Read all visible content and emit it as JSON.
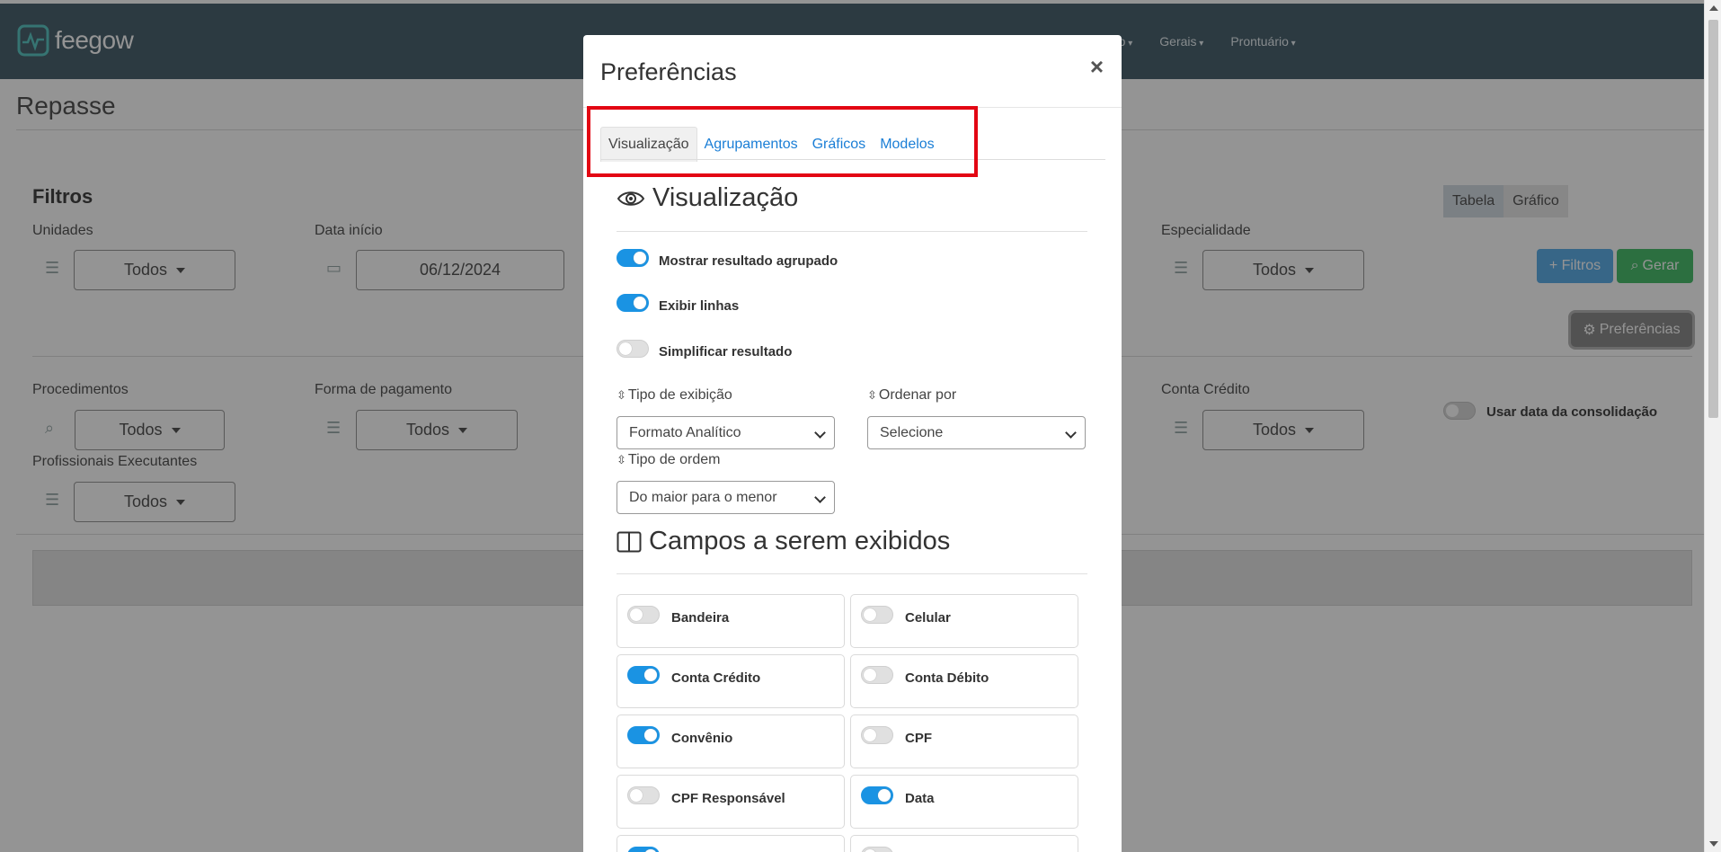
{
  "app": {
    "logo_text": "feegow"
  },
  "nav": {
    "items": [
      "ro",
      "Gerais",
      "Prontuário"
    ]
  },
  "page": {
    "title": "Repasse"
  },
  "filters": {
    "title": "Filtros",
    "unidades": {
      "label": "Unidades",
      "value": "Todos"
    },
    "data_inicio": {
      "label": "Data início",
      "value": "06/12/2024"
    },
    "especialidade": {
      "label": "Especialidade",
      "value": "Todos"
    },
    "procedimentos": {
      "label": "Procedimentos",
      "value": "Todos"
    },
    "forma_pagamento": {
      "label": "Forma de pagamento",
      "value": "Todos"
    },
    "conta_credito": {
      "label": "Conta Crédito",
      "value": "Todos"
    },
    "profissionais": {
      "label": "Profissionais Executantes",
      "value": "Todos"
    },
    "usar_data": {
      "label": "Usar data da consolidação",
      "on": false
    }
  },
  "view_switch": {
    "tabela": "Tabela",
    "grafico": "Gráfico",
    "active": "Tabela"
  },
  "actions": {
    "filtros": "+ Filtros",
    "gerar": "Gerar",
    "preferencias": "Preferências"
  },
  "modal": {
    "title": "Preferências",
    "close": "×",
    "tabs": [
      {
        "label": "Visualização",
        "active": true
      },
      {
        "label": "Agrupamentos",
        "active": false
      },
      {
        "label": "Gráficos",
        "active": false
      },
      {
        "label": "Modelos",
        "active": false
      }
    ],
    "visualizacao": {
      "heading": "Visualização",
      "options": [
        {
          "label": "Mostrar resultado agrupado",
          "on": true
        },
        {
          "label": "Exibir linhas",
          "on": true
        },
        {
          "label": "Simplificar resultado",
          "on": false
        }
      ],
      "tipo_exibicao": {
        "label": "Tipo de exibição",
        "value": "Formato Analítico"
      },
      "ordenar_por": {
        "label": "Ordenar por",
        "value": "Selecione"
      },
      "tipo_ordem": {
        "label": "Tipo de ordem",
        "value": "Do maior para o menor"
      }
    },
    "campos": {
      "heading": "Campos a serem exibidos",
      "items": [
        {
          "label": "Bandeira",
          "on": false
        },
        {
          "label": "Celular",
          "on": false
        },
        {
          "label": "Conta Crédito",
          "on": true
        },
        {
          "label": "Conta Débito",
          "on": false
        },
        {
          "label": "Convênio",
          "on": true
        },
        {
          "label": "CPF",
          "on": false
        },
        {
          "label": "CPF Responsável",
          "on": false
        },
        {
          "label": "Data",
          "on": true
        },
        {
          "label": "",
          "on": true
        },
        {
          "label": "",
          "on": false
        }
      ]
    }
  },
  "colors": {
    "topbar": "#4d6471",
    "toggle_on": "#1a93e3",
    "link": "#1a7ed6",
    "highlight": "#e30613"
  }
}
